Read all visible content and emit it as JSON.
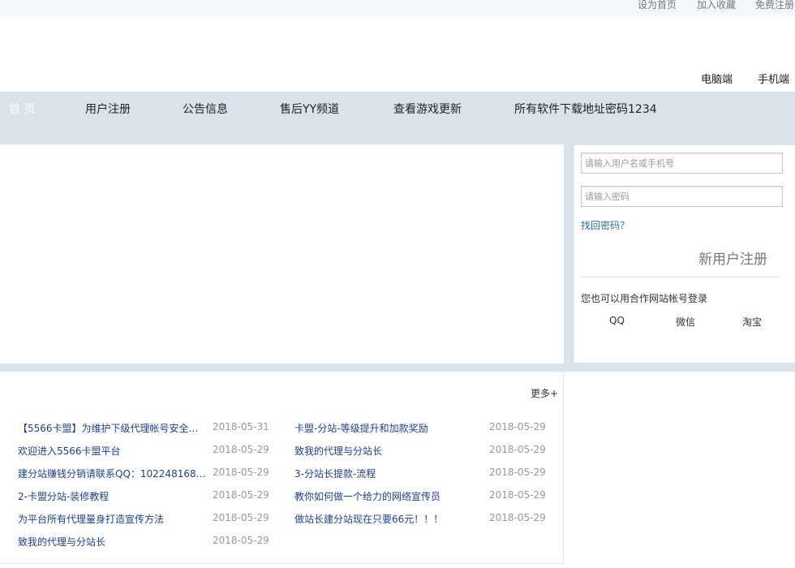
{
  "topbar": {
    "set_home": "设为首页",
    "add_favorite": "加入收藏",
    "free_register": "免费注册"
  },
  "device": {
    "pc": "电脑端",
    "mobile": "手机端"
  },
  "nav": {
    "items": [
      {
        "label": "首 页"
      },
      {
        "label": "用户注册"
      },
      {
        "label": "公告信息"
      },
      {
        "label": "售后YY频道"
      },
      {
        "label": "查看游戏更新"
      },
      {
        "label": "所有软件下载地址密码1234"
      }
    ]
  },
  "login": {
    "username_placeholder": "请输入用户名或手机号",
    "password_placeholder": "请输入密码",
    "forgot": "找回密码？",
    "register": "新用户注册",
    "partner_text": "您也可以用合作网站帐号登录",
    "partners": [
      "QQ",
      "微信",
      "淘宝"
    ]
  },
  "news": {
    "more": "更多+",
    "left": [
      {
        "title": "【5566卡盟】为维护下级代理帐号安全与...",
        "date": "2018-05-31"
      },
      {
        "title": "欢迎进入5566卡盟平台",
        "date": "2018-05-29"
      },
      {
        "title": "建分站赚钱分销请联系QQ：1022481681...",
        "date": "2018-05-29"
      },
      {
        "title": "2-卡盟分站-装修教程",
        "date": "2018-05-29"
      },
      {
        "title": "为平台所有代理量身打造宣传方法",
        "date": "2018-05-29"
      },
      {
        "title": "致我的代理与分站长",
        "date": "2018-05-29"
      }
    ],
    "right": [
      {
        "title": "卡盟-分站-等级提升和加款奖励",
        "date": "2018-05-29"
      },
      {
        "title": "致我的代理与分站长",
        "date": "2018-05-29"
      },
      {
        "title": "3-分站长提款-流程",
        "date": "2018-05-29"
      },
      {
        "title": "教你如何做一个给力的网络宣传员",
        "date": "2018-05-29"
      },
      {
        "title": "做站长建分站现在只要66元！！！",
        "date": "2018-05-29"
      }
    ]
  },
  "colors": {
    "nav_bg": "#dbe3ea",
    "link_blue": "#1d3f93",
    "date_gray": "#999999"
  }
}
